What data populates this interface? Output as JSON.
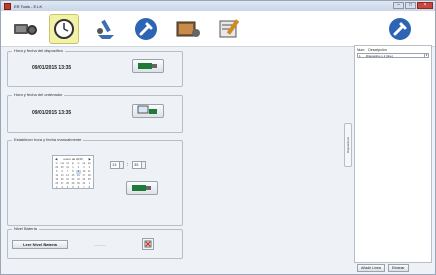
{
  "window": {
    "title": "ER Tools - E.LK"
  },
  "toolbar": {
    "tools": [
      {
        "icon": "camera-reader-icon"
      },
      {
        "icon": "clock-icon"
      },
      {
        "icon": "tool-arrow-icon"
      },
      {
        "icon": "wrench-circle-icon"
      },
      {
        "icon": "camera-settings-icon"
      },
      {
        "icon": "notepad-pencil-icon"
      }
    ],
    "right_icon": "wrench-circle-icon"
  },
  "device_time": {
    "legend": "Hora y fecha del dispositivo",
    "value": "09/01/2015  13:35"
  },
  "pc_time": {
    "legend": "Hora y fecha del ordenador",
    "value": "09/01/2015  13:35"
  },
  "manual_time": {
    "legend": "Establecer hora y fecha manualmente",
    "calendar_month": "enero de 2015",
    "weekdays": [
      "lu",
      "ma",
      "mi",
      "ju",
      "vi",
      "sá",
      "do"
    ],
    "days": [
      "29",
      "30",
      "31",
      "1",
      "2",
      "3",
      "4",
      "5",
      "6",
      "7",
      "8",
      "9",
      "10",
      "11",
      "12",
      "13",
      "14",
      "15",
      "16",
      "17",
      "18",
      "19",
      "20",
      "21",
      "22",
      "23",
      "24",
      "25",
      "26",
      "27",
      "28",
      "29",
      "30",
      "31",
      "1",
      "2",
      "3",
      "4",
      "5",
      "6",
      "7",
      "8"
    ],
    "hour": "13",
    "separator": ":",
    "minute": "35"
  },
  "battery": {
    "legend": "Nivel Batería",
    "read_label": "Leer Nivel Batería",
    "value": "---------"
  },
  "side_tab": {
    "label": "Dispositivos"
  },
  "devices_panel": {
    "col_num": "Num",
    "col_desc": "Descripción",
    "rows": [
      {
        "num": "1",
        "desc": "Dispositivo y 1 (line)"
      }
    ]
  },
  "bottom": {
    "add_label": "Añadir Línea",
    "delete_label": "Eliminar"
  }
}
